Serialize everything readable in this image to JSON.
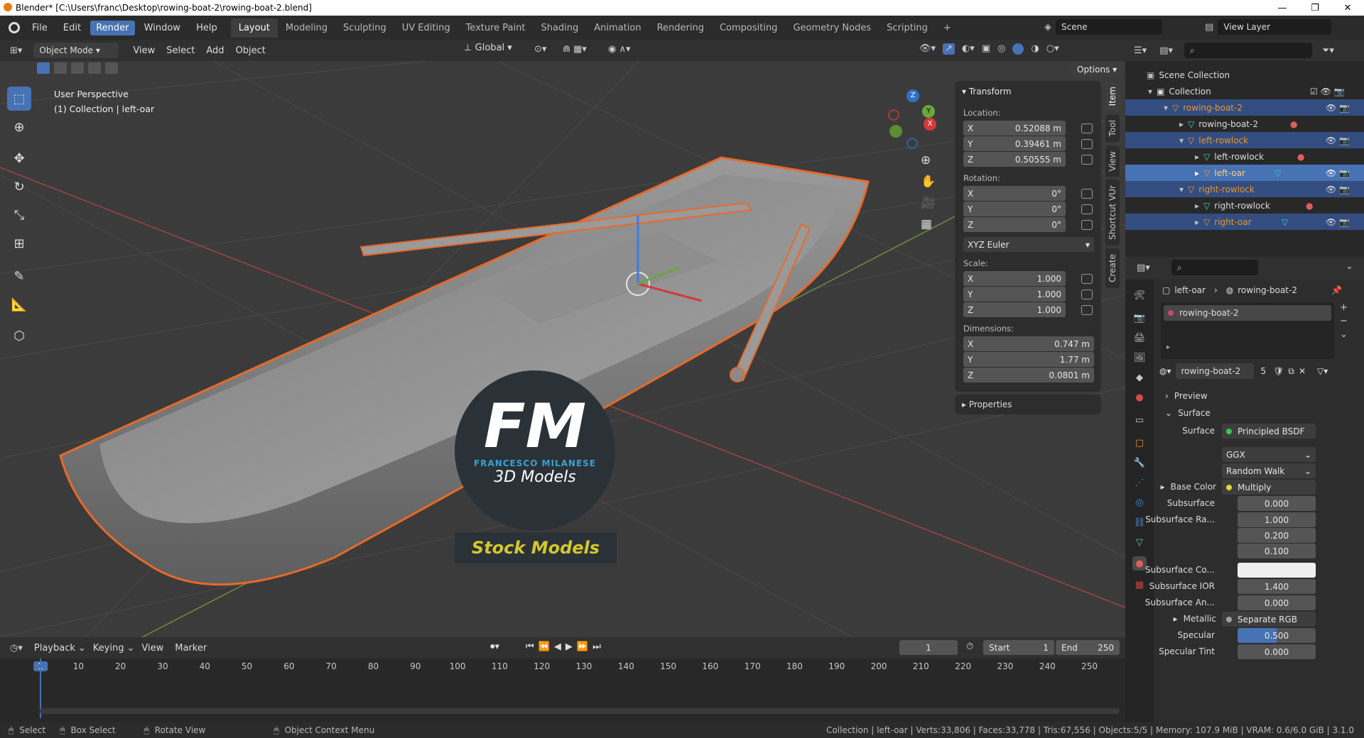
{
  "window": {
    "title": "Blender* [C:\\Users\\franc\\Desktop\\rowing-boat-2\\rowing-boat-2.blend]",
    "min": "—",
    "max": "❐",
    "close": "✕"
  },
  "menu": [
    "File",
    "Edit",
    "Render",
    "Window",
    "Help"
  ],
  "workspaces": [
    "Layout",
    "Modeling",
    "Sculpting",
    "UV Editing",
    "Texture Paint",
    "Shading",
    "Animation",
    "Rendering",
    "Compositing",
    "Geometry Nodes",
    "Scripting",
    "+"
  ],
  "scene": {
    "label": "Scene",
    "view_layer": "View Layer"
  },
  "viewport": {
    "mode": "Object Mode",
    "menus": [
      "View",
      "Select",
      "Add",
      "Object"
    ],
    "orientation": "Global",
    "options": "Options",
    "info_line1": "User Perspective",
    "info_line2": "(1) Collection | left-oar"
  },
  "gizmo": {
    "x": "X",
    "y": "Y",
    "z": "Z"
  },
  "transform": {
    "title": "Transform",
    "location_label": "Location:",
    "location": {
      "x": "0.52088 m",
      "y": "0.39461 m",
      "z": "0.50555 m"
    },
    "rotation_label": "Rotation:",
    "rotation": {
      "x": "0°",
      "y": "0°",
      "z": "0°"
    },
    "rotation_mode": "XYZ Euler",
    "scale_label": "Scale:",
    "scale": {
      "x": "1.000",
      "y": "1.000",
      "z": "1.000"
    },
    "dimensions_label": "Dimensions:",
    "dimensions": {
      "x": "0.747 m",
      "y": "1.77 m",
      "z": "0.0801 m"
    },
    "properties": "Properties",
    "axis": [
      "X",
      "Y",
      "Z"
    ]
  },
  "sidebar_tabs": [
    "Item",
    "Tool",
    "View",
    "Shortcut VUr",
    "Create"
  ],
  "watermark": {
    "logo": "FM",
    "name": "FRANCESCO MILANESE",
    "sub": "3D Models",
    "stock": "Stock Models"
  },
  "outliner": {
    "rows": [
      {
        "label": "Scene Collection",
        "indent": 0
      },
      {
        "label": "Collection",
        "indent": 1
      },
      {
        "label": "rowing-boat-2",
        "indent": 2
      },
      {
        "label": "rowing-boat-2",
        "indent": 3
      },
      {
        "label": "left-rowlock",
        "indent": 3
      },
      {
        "label": "left-rowlock",
        "indent": 4
      },
      {
        "label": "left-oar",
        "indent": 4
      },
      {
        "label": "right-rowlock",
        "indent": 3
      },
      {
        "label": "right-rowlock",
        "indent": 4
      },
      {
        "label": "right-oar",
        "indent": 4
      }
    ]
  },
  "properties": {
    "breadcrumb_obj": "left-oar",
    "breadcrumb_mat": "rowing-boat-2",
    "slot": "rowing-boat-2",
    "material": "rowing-boat-2",
    "users": "5",
    "preview": "Preview",
    "surface_section": "Surface",
    "surface_label": "Surface",
    "surface_value": "Principled BSDF",
    "distribution": "GGX",
    "subsurface_method": "Random Walk",
    "rows": [
      {
        "label": "Base Color",
        "value": "Multiply"
      },
      {
        "label": "Subsurface",
        "value": "0.000"
      },
      {
        "label": "Subsurface Ra...",
        "value": "1.000"
      },
      {
        "label": "",
        "value": "0.200"
      },
      {
        "label": "",
        "value": "0.100"
      },
      {
        "label": "Subsurface Co...",
        "value": ""
      },
      {
        "label": "Subsurface IOR",
        "value": "1.400"
      },
      {
        "label": "Subsurface An...",
        "value": "0.000"
      },
      {
        "label": "Metallic",
        "value": "Separate RGB"
      },
      {
        "label": "Specular",
        "value": "0.500"
      },
      {
        "label": "Specular Tint",
        "value": "0.000"
      }
    ]
  },
  "timeline": {
    "menus": [
      "Playback",
      "Keying",
      "View",
      "Marker"
    ],
    "current": "1",
    "start_label": "Start",
    "start": "1",
    "end_label": "End",
    "end": "250",
    "ticks": [
      "1",
      "10",
      "20",
      "30",
      "40",
      "50",
      "60",
      "70",
      "80",
      "90",
      "100",
      "110",
      "120",
      "130",
      "140",
      "150",
      "160",
      "170",
      "180",
      "190",
      "200",
      "210",
      "220",
      "230",
      "240",
      "250"
    ]
  },
  "status": {
    "select": "Select",
    "box_select": "Box Select",
    "rotate": "Rotate View",
    "context": "Object Context Menu",
    "stats": "Collection | left-oar | Verts:33,806 | Faces:33,778 | Tris:67,556 | Objects:5/5 | Memory: 107.9 MiB | VRAM: 0.6/6.0 GiB | 3.1.0"
  }
}
